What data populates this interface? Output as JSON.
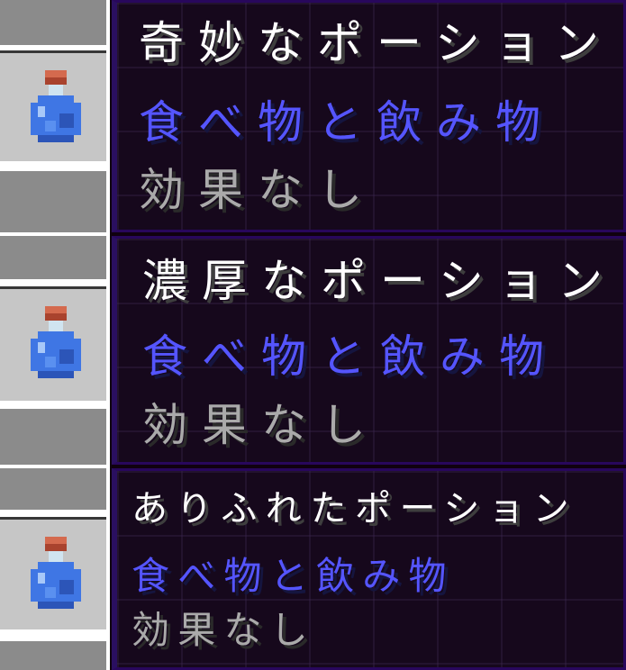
{
  "tooltips": [
    {
      "title": "奇妙なポーション",
      "category": "食べ物と飲み物",
      "effect": "効果なし",
      "icon": "potion-bottle-icon"
    },
    {
      "title": "濃厚なポーション",
      "category": "食べ物と飲み物",
      "effect": "効果なし",
      "icon": "potion-bottle-icon"
    },
    {
      "title": "ありふれたポーション",
      "category": "食べ物と飲み物",
      "effect": "効果なし",
      "icon": "potion-bottle-icon"
    }
  ],
  "colors": {
    "title": "#ffffff",
    "category": "#5555ff",
    "effect": "#aaaaaa",
    "tooltip_bg": "#16081c",
    "tooltip_border": "#28075c",
    "slot": "#8b8b8b",
    "slot_highlight": "#c6c6c6",
    "potion_liquid": "#3f76e4",
    "potion_cork": "#c0583f"
  }
}
